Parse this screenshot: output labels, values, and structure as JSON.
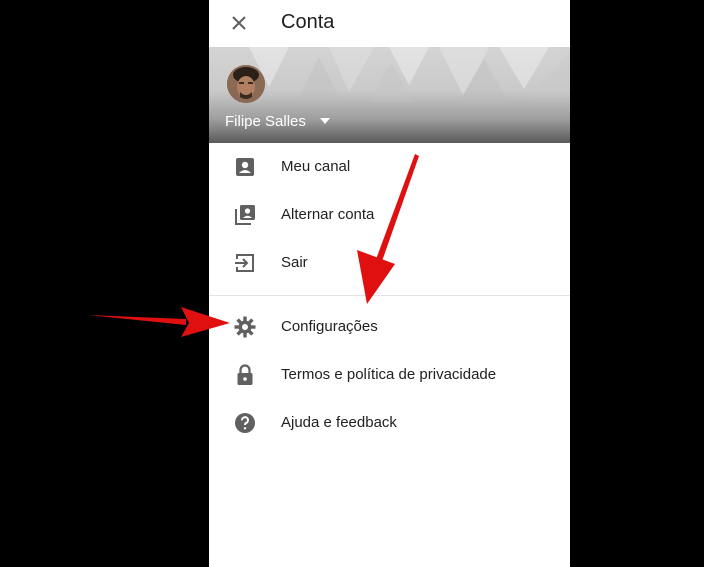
{
  "header": {
    "title": "Conta"
  },
  "account": {
    "name": "Filipe Salles"
  },
  "menu_section_1": [
    {
      "label": "Meu canal",
      "icon": "account-box-icon"
    },
    {
      "label": "Alternar conta",
      "icon": "switch-account-icon"
    },
    {
      "label": "Sair",
      "icon": "sign-out-icon"
    }
  ],
  "menu_section_2": [
    {
      "label": "Configurações",
      "icon": "gear-icon"
    },
    {
      "label": "Termos e política de privacidade",
      "icon": "lock-icon"
    },
    {
      "label": "Ajuda e feedback",
      "icon": "help-icon"
    }
  ],
  "colors": {
    "icon": "#606060",
    "annotation_arrow": "#e01010",
    "background": "#000000"
  }
}
